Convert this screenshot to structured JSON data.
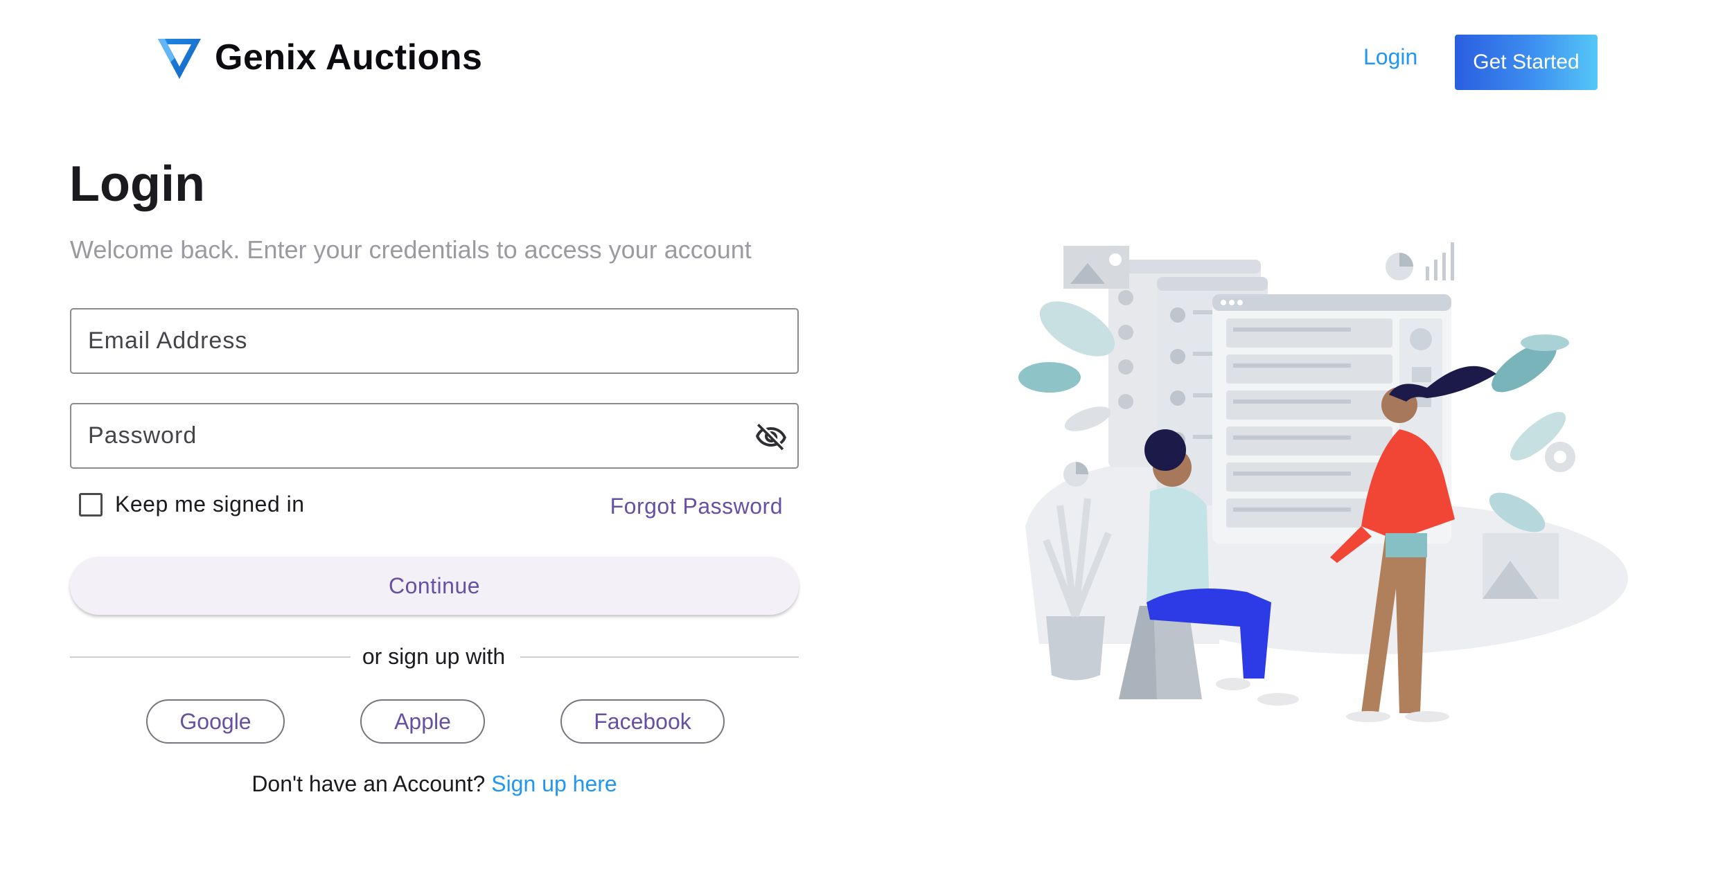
{
  "header": {
    "brand": "Genix Auctions",
    "login_link": "Login",
    "get_started": "Get Started"
  },
  "login": {
    "title": "Login",
    "subtitle": "Welcome back. Enter your credentials to access your account",
    "email_placeholder": "Email Address",
    "password_placeholder": "Password",
    "keep_signed_in": "Keep me signed in",
    "forgot_password": "Forgot Password",
    "continue": "Continue",
    "divider": "or sign up with",
    "social": [
      "Google",
      "Apple",
      "Facebook"
    ],
    "no_account": "Don't have an Account?",
    "signup_link": "Sign up here"
  },
  "icons": {
    "logo": "triangle-logo-icon",
    "password_toggle": "eye-off-icon",
    "illustration": "team-dashboard-illustration"
  },
  "colors": {
    "accent_blue": "#2196f3",
    "accent_purple": "#6750a4",
    "button_gradient_start": "#2a5ee0",
    "button_gradient_end": "#55c7f7"
  }
}
